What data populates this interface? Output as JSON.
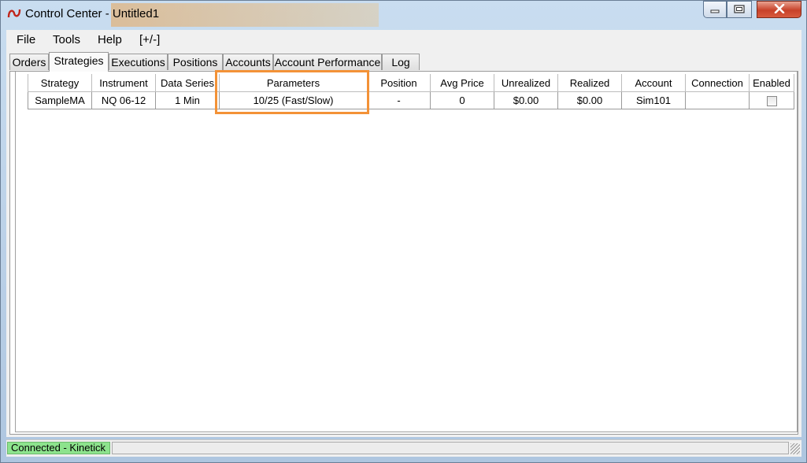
{
  "window": {
    "title": "Control Center - Untitled1",
    "accent": "#f39237",
    "status_ok_color": "#8de38d"
  },
  "icons": {
    "app": "ninja-logo-icon",
    "minimize": "minimize-icon",
    "maximize": "maximize-icon",
    "close": "close-icon",
    "checkbox": "checkbox-icon"
  },
  "menu": [
    {
      "label": "File"
    },
    {
      "label": "Tools"
    },
    {
      "label": "Help"
    },
    {
      "label": "[+/-]"
    }
  ],
  "tabs": [
    {
      "label": "Orders"
    },
    {
      "label": "Strategies",
      "active": true
    },
    {
      "label": "Executions"
    },
    {
      "label": "Positions"
    },
    {
      "label": "Accounts"
    },
    {
      "label": "Account Performance"
    },
    {
      "label": "Log"
    }
  ],
  "grid": {
    "columns": [
      "Strategy",
      "Instrument",
      "Data Series",
      "Parameters",
      "Position",
      "Avg Price",
      "Unrealized",
      "Realized",
      "Account",
      "Connection",
      "Enabled"
    ],
    "rows": [
      {
        "strategy": "SampleMA",
        "instrument": "NQ 06-12",
        "data_series": "1 Min",
        "parameters": "10/25 (Fast/Slow)",
        "position": "-",
        "avg_price": "0",
        "unrealized": "$0.00",
        "realized": "$0.00",
        "account": "Sim101",
        "connection": "",
        "enabled": false
      }
    ]
  },
  "status": {
    "connection": "Connected - Kinetick"
  }
}
